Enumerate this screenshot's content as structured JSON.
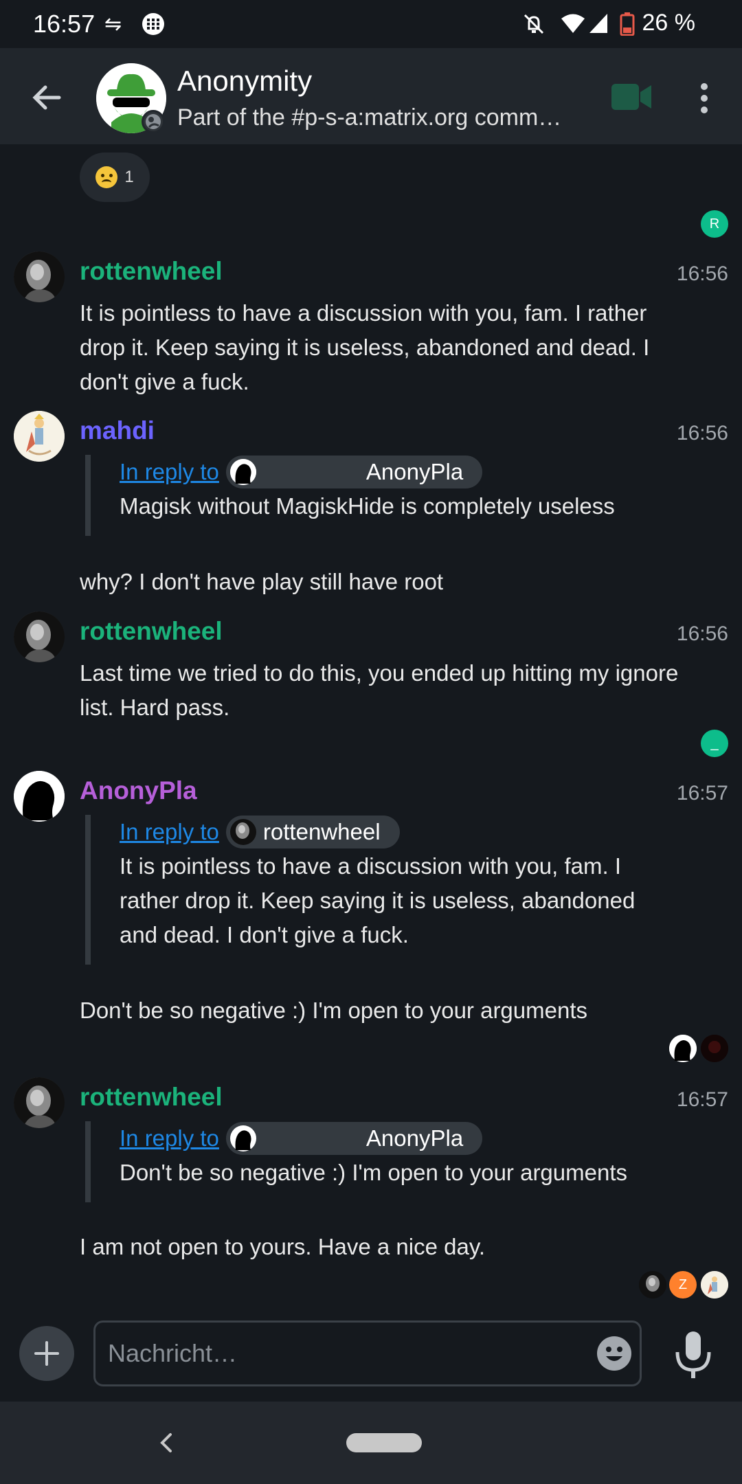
{
  "status_bar": {
    "time": "16:57",
    "battery": "26 %"
  },
  "header": {
    "room_name": "Anonymity",
    "room_topic": "Part of the #p-s-a:matrix.org comm…"
  },
  "timeline": {
    "top_reaction": {
      "emoji": "crying-face",
      "count": "1"
    },
    "read_marker_1": "R",
    "read_marker_2": "_",
    "read_marker_3": "Z",
    "messages": [
      {
        "sender": "rottenwheel",
        "time": "16:56",
        "body": "It is pointless to have a discussion with you, fam. I rather drop it. Keep saying it is useless, abandoned and dead. I don't give a fuck."
      },
      {
        "sender": "mahdi",
        "time": "16:56",
        "reply_label": "In reply to",
        "reply_user": "AnonyPla",
        "reply_text": "Magisk without MagiskHide is completely useless",
        "body": "why? I don't have play still have root"
      },
      {
        "sender": "rottenwheel",
        "time": "16:56",
        "body": "Last time we tried to do this, you ended up hitting my ignore list. Hard pass."
      },
      {
        "sender": "AnonyPla",
        "time": "16:57",
        "reply_label": "In reply to",
        "reply_user": "rottenwheel",
        "reply_text": "It is pointless to have a discussion with you, fam. I rather drop it. Keep saying it is useless, abandoned and dead. I don't give a fuck.",
        "body": "Don't be so negative :) I'm open to your arguments"
      },
      {
        "sender": "rottenwheel",
        "time": "16:57",
        "reply_label": "In reply to",
        "reply_user": "AnonyPla",
        "reply_text": "Don't be so negative :) I'm open to your arguments",
        "body": "I am not open to yours. Have a nice day."
      }
    ]
  },
  "composer": {
    "placeholder": "Nachricht…"
  },
  "colors": {
    "background": "#15191e",
    "header": "#21262c",
    "sender_green": "#1bb37b",
    "sender_blue": "#6c63ff",
    "sender_purple": "#b65fd9",
    "link": "#1e88e5",
    "video_icon": "#1d5b46"
  }
}
